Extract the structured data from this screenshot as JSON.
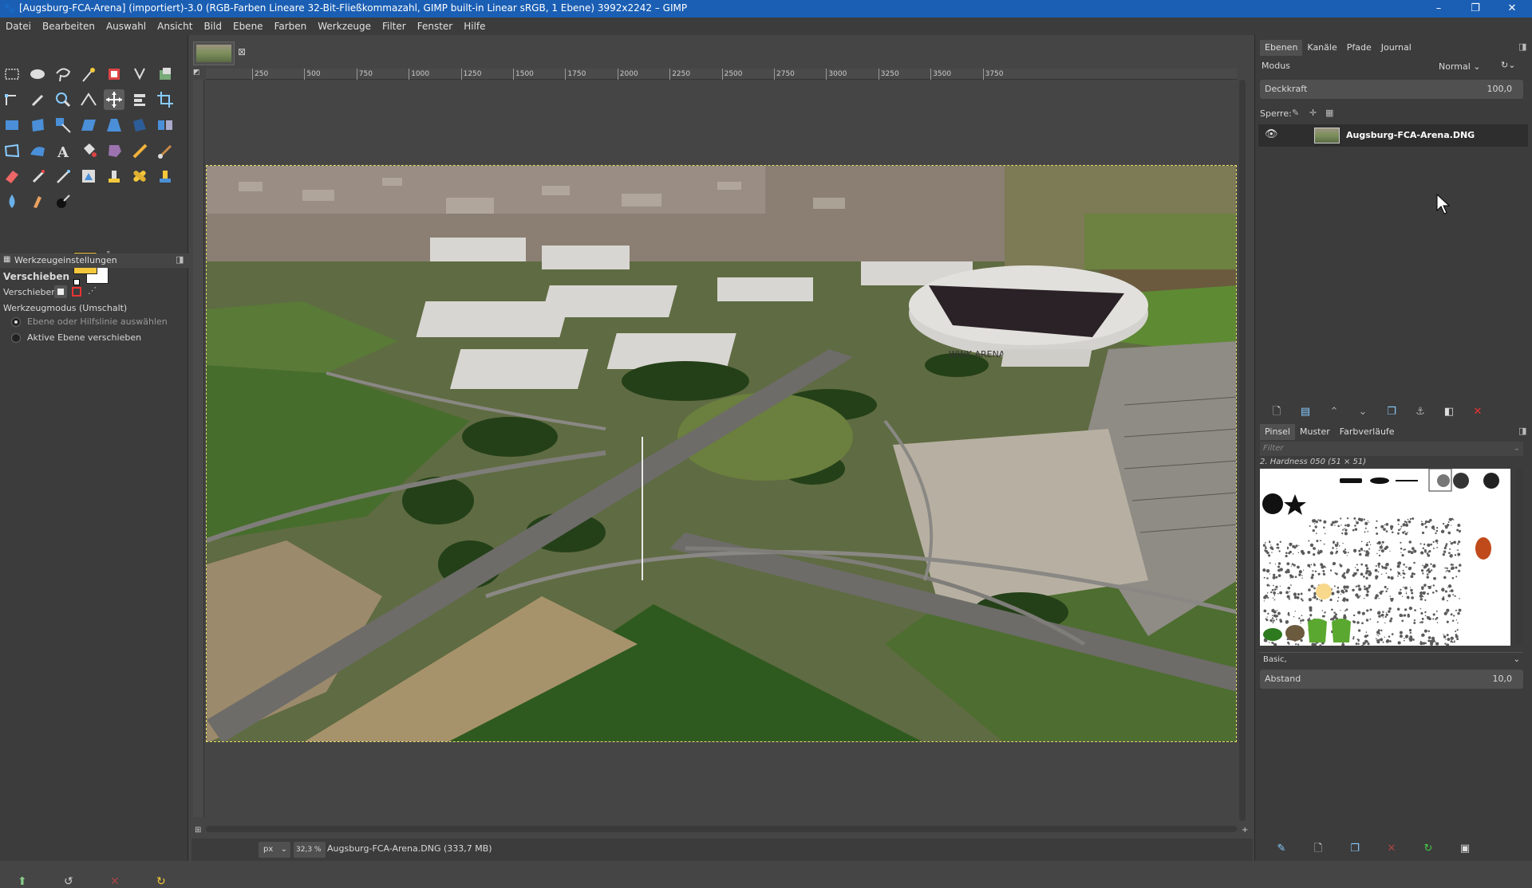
{
  "window": {
    "title": "[Augsburg-FCA-Arena] (importiert)-3.0 (RGB-Farben Lineare 32-Bit-Fließkommazahl, GIMP built-in Linear sRGB, 1 Ebene) 3992x2242 – GIMP",
    "minimize": "–",
    "maximize": "❐",
    "close": "✕"
  },
  "menu": [
    "Datei",
    "Bearbeiten",
    "Auswahl",
    "Ansicht",
    "Bild",
    "Ebene",
    "Farben",
    "Werkzeuge",
    "Filter",
    "Fenster",
    "Hilfe"
  ],
  "colors": {
    "fg": "#f4c83a",
    "bg": "#ffffff",
    "accent": "#1b5fb4"
  },
  "tool_options": {
    "tab_label": "Werkzeugeinstellungen",
    "tool_name": "Verschieben",
    "move_label": "Verschieben:",
    "mode_label": "Werkzeugmodus (Umschalt)",
    "option1": "Ebene oder Hilfslinie auswählen",
    "option2": "Aktive Ebene verschieben"
  },
  "ruler": {
    "labels": [
      "250",
      "500",
      "750",
      "1000",
      "1250",
      "1500",
      "1750",
      "2000",
      "2250",
      "2500",
      "2750",
      "3000",
      "3250",
      "3500",
      "3750"
    ]
  },
  "status": {
    "unit": "px",
    "zoom": "32,3 %",
    "file": "Augsburg-FCA-Arena.DNG (333,7 MB)"
  },
  "layers": {
    "tabs": [
      "Ebenen",
      "Kanäle",
      "Pfade",
      "Journal"
    ],
    "mode_label": "Modus",
    "mode_value": "Normal",
    "opacity_label": "Deckkraft",
    "opacity_value": "100,0",
    "lock_label": "Sperre:",
    "layer_name": "Augsburg-FCA-Arena.DNG"
  },
  "brushes": {
    "tabs": [
      "Pinsel",
      "Muster",
      "Farbverläufe"
    ],
    "filter_placeholder": "Filter",
    "current": "2. Hardness 050 (51 × 51)",
    "preset": "Basic,",
    "spacing_label": "Abstand",
    "spacing_value": "10,0"
  },
  "photo": {
    "stadium_text": "WWK ARENA"
  }
}
